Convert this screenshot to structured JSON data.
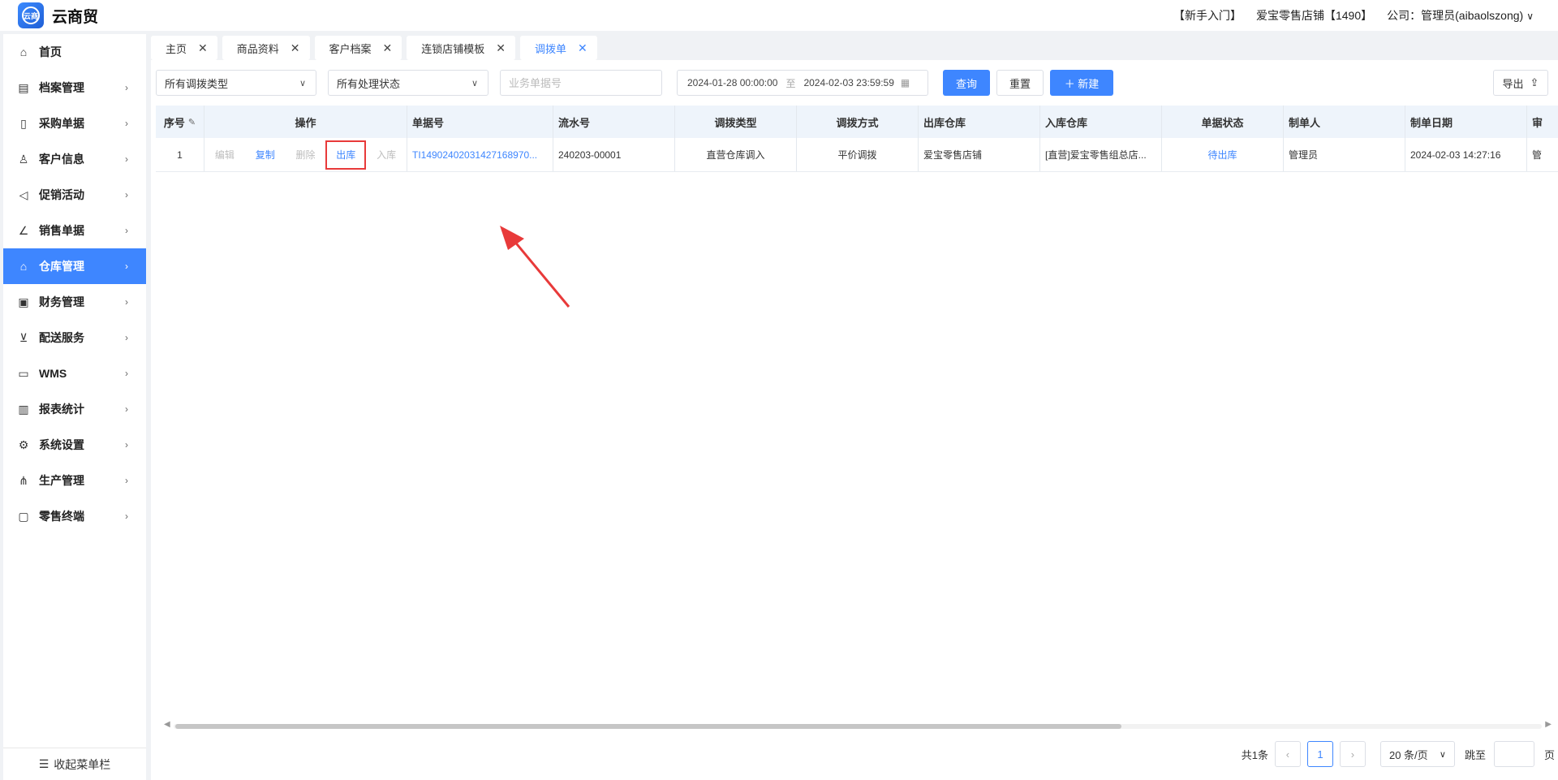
{
  "app": {
    "name": "云商贸",
    "logo_text": "云商"
  },
  "header": {
    "guide": "【新手入门】",
    "store": "爱宝零售店铺【1490】",
    "company": "公司：管理员(aibaolszong)"
  },
  "sidebar": {
    "items": [
      {
        "label": "首页",
        "icon": "home-icon",
        "glyph": "⌂"
      },
      {
        "label": "档案管理",
        "icon": "archive-icon",
        "glyph": "▤"
      },
      {
        "label": "采购单据",
        "icon": "purchase-doc-icon",
        "glyph": "▯"
      },
      {
        "label": "客户信息",
        "icon": "user-icon",
        "glyph": "♙"
      },
      {
        "label": "促销活动",
        "icon": "megaphone-icon",
        "glyph": "◁"
      },
      {
        "label": "销售单据",
        "icon": "line-chart-icon",
        "glyph": "∠"
      },
      {
        "label": "仓库管理",
        "icon": "warehouse-icon",
        "glyph": "⌂"
      },
      {
        "label": "财务管理",
        "icon": "finance-icon",
        "glyph": "▣"
      },
      {
        "label": "配送服务",
        "icon": "cart-icon",
        "glyph": "⊻"
      },
      {
        "label": "WMS",
        "icon": "truck-icon",
        "glyph": "▭"
      },
      {
        "label": "报表统计",
        "icon": "bar-chart-icon",
        "glyph": "▥"
      },
      {
        "label": "系统设置",
        "icon": "gear-icon",
        "glyph": "⚙"
      },
      {
        "label": "生产管理",
        "icon": "network-icon",
        "glyph": "⋔"
      },
      {
        "label": "零售终端",
        "icon": "bag-icon",
        "glyph": "▢"
      }
    ],
    "active_index": 6,
    "collapse_label": "收起菜单栏"
  },
  "tabs": [
    "主页",
    "商品资料",
    "客户档案",
    "连锁店铺模板",
    "调拨单"
  ],
  "filters": {
    "type_select": "所有调拨类型",
    "status_select": "所有处理状态",
    "doc_placeholder": "业务单据号",
    "date_start": "2024-01-28 00:00:00",
    "date_sep": "至",
    "date_end": "2024-02-03 23:59:59",
    "query": "查询",
    "reset": "重置",
    "new": "＋ 新建",
    "export": "导出"
  },
  "table": {
    "headers": [
      "序号",
      "操作",
      "单据号",
      "流水号",
      "调拨类型",
      "调拨方式",
      "出库仓库",
      "入库仓库",
      "单据状态",
      "制单人",
      "制单日期",
      "审"
    ],
    "rows": [
      {
        "seq": "1",
        "ops": [
          "编辑",
          "复制",
          "删除",
          "出库",
          "入库"
        ],
        "doc_no": "TI14902402031427168970...",
        "serial": "240203-00001",
        "type": "直营仓库调入",
        "method": "平价调拨",
        "out_wh": "爱宝零售店铺",
        "in_wh": "[直营]爱宝零售组总店...",
        "status": "待出库",
        "maker": "管理员",
        "date": "2024-02-03 14:27:16",
        "audit": "管"
      }
    ]
  },
  "pagination": {
    "total": "共1条",
    "current": "1",
    "page_size": "20 条/页",
    "jump": "跳至",
    "page_unit": "页"
  },
  "colors": {
    "accent": "#3e86ff",
    "highlight": "#e83a3a"
  }
}
